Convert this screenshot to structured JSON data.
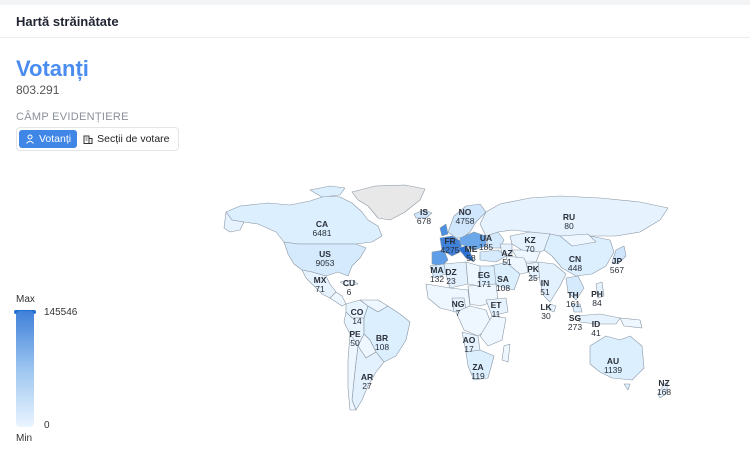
{
  "header": {
    "title": "Hartă străinătate"
  },
  "metric": {
    "title": "Votanți",
    "value": "803.291"
  },
  "field_label": "CÂMP EVIDENȚIERE",
  "buttons": [
    {
      "label": "Votanți",
      "icon": "person-icon",
      "active": true
    },
    {
      "label": "Secții de votare",
      "icon": "building-icon",
      "active": false
    }
  ],
  "legend": {
    "max_label": "Max",
    "min_label": "Min",
    "max_value": "145546",
    "min_value": "0"
  },
  "colors": {
    "accent": "#3f86e6",
    "land": "#e4f2ff",
    "land_dark": "#1f6fd1",
    "unknown": "#e8e8e8"
  },
  "countries": [
    {
      "code": "CA",
      "value": "6481"
    },
    {
      "code": "US",
      "value": "9053"
    },
    {
      "code": "MX",
      "value": "71"
    },
    {
      "code": "CU",
      "value": "6"
    },
    {
      "code": "CO",
      "value": "14"
    },
    {
      "code": "PE",
      "value": "50"
    },
    {
      "code": "BR",
      "value": "108"
    },
    {
      "code": "AR",
      "value": "27"
    },
    {
      "code": "IS",
      "value": "678"
    },
    {
      "code": "NO",
      "value": "4758"
    },
    {
      "code": "FR",
      "value": "4275"
    },
    {
      "code": "UA",
      "value": "185"
    },
    {
      "code": "ME",
      "value": "58"
    },
    {
      "code": "MA",
      "value": "132"
    },
    {
      "code": "DZ",
      "value": "23"
    },
    {
      "code": "EG",
      "value": "171"
    },
    {
      "code": "AZ",
      "value": "51"
    },
    {
      "code": "SA",
      "value": "108"
    },
    {
      "code": "KZ",
      "value": "70"
    },
    {
      "code": "PK",
      "value": "25"
    },
    {
      "code": "RU",
      "value": "80"
    },
    {
      "code": "CN",
      "value": "448"
    },
    {
      "code": "JP",
      "value": "567"
    },
    {
      "code": "IN",
      "value": "51"
    },
    {
      "code": "LK",
      "value": "30"
    },
    {
      "code": "TH",
      "value": "161"
    },
    {
      "code": "PH",
      "value": "84"
    },
    {
      "code": "SG",
      "value": "273"
    },
    {
      "code": "ID",
      "value": "41"
    },
    {
      "code": "NG",
      "value": "7"
    },
    {
      "code": "ET",
      "value": "11"
    },
    {
      "code": "AO",
      "value": "17"
    },
    {
      "code": "ZA",
      "value": "119"
    },
    {
      "code": "AU",
      "value": "1139"
    },
    {
      "code": "NZ",
      "value": "168"
    }
  ]
}
